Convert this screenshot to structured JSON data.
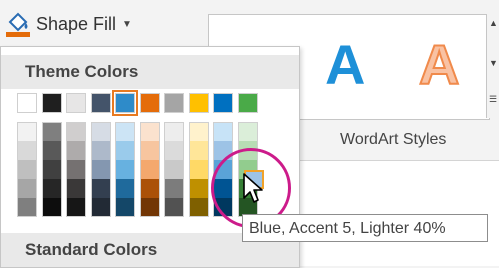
{
  "shape_fill": {
    "label": "Shape Fill",
    "accent_color": "#e46c0a"
  },
  "dropdown": {
    "theme_colors_header": "Theme Colors",
    "standard_colors_header": "Standard Colors",
    "theme_top_row": [
      "#ffffff",
      "#1f1f1f",
      "#e7e6e6",
      "#44546a",
      "#2e8bc9",
      "#e46c0a",
      "#a5a5a5",
      "#ffc000",
      "#0070c0",
      "#4aaa48"
    ],
    "selected_index": 4,
    "shade_columns": [
      [
        "#f2f2f2",
        "#d9d9d9",
        "#bfbfbf",
        "#a6a6a6",
        "#7f7f7f"
      ],
      [
        "#7f7f7f",
        "#595959",
        "#404040",
        "#262626",
        "#0d0d0d"
      ],
      [
        "#d0cece",
        "#aeabab",
        "#757171",
        "#3a3838",
        "#161616"
      ],
      [
        "#d6dce5",
        "#adb9ca",
        "#8497b0",
        "#333f50",
        "#222a35"
      ],
      [
        "#cce4f5",
        "#9acbeb",
        "#67b1e0",
        "#1f6a9c",
        "#144768"
      ],
      [
        "#fbe2ce",
        "#f7c59f",
        "#f4a86d",
        "#ab5108",
        "#723605"
      ],
      [
        "#ededed",
        "#dbdbdb",
        "#c9c9c9",
        "#7c7c7c",
        "#525252"
      ],
      [
        "#fff2cc",
        "#ffe699",
        "#ffd966",
        "#bf9000",
        "#7f6000"
      ],
      [
        "#c7e3f7",
        "#9dc3e6",
        "#5aa3d8",
        "#005493",
        "#00385f"
      ],
      [
        "#dbeed9",
        "#b7ddb4",
        "#92cc8e",
        "#367f35",
        "#245523"
      ]
    ]
  },
  "wordart": {
    "partial_glyph": "A",
    "blue_glyph": "A",
    "blue_color": "#1e90d8",
    "orange_glyph": "A",
    "orange_fill": "#f9c2a3",
    "orange_outline": "#f08a4b",
    "group_label": "WordArt Styles"
  },
  "tooltip": {
    "text": "Blue, Accent 5, Lighter 40%"
  },
  "highlight_color": "#cc1b8a"
}
